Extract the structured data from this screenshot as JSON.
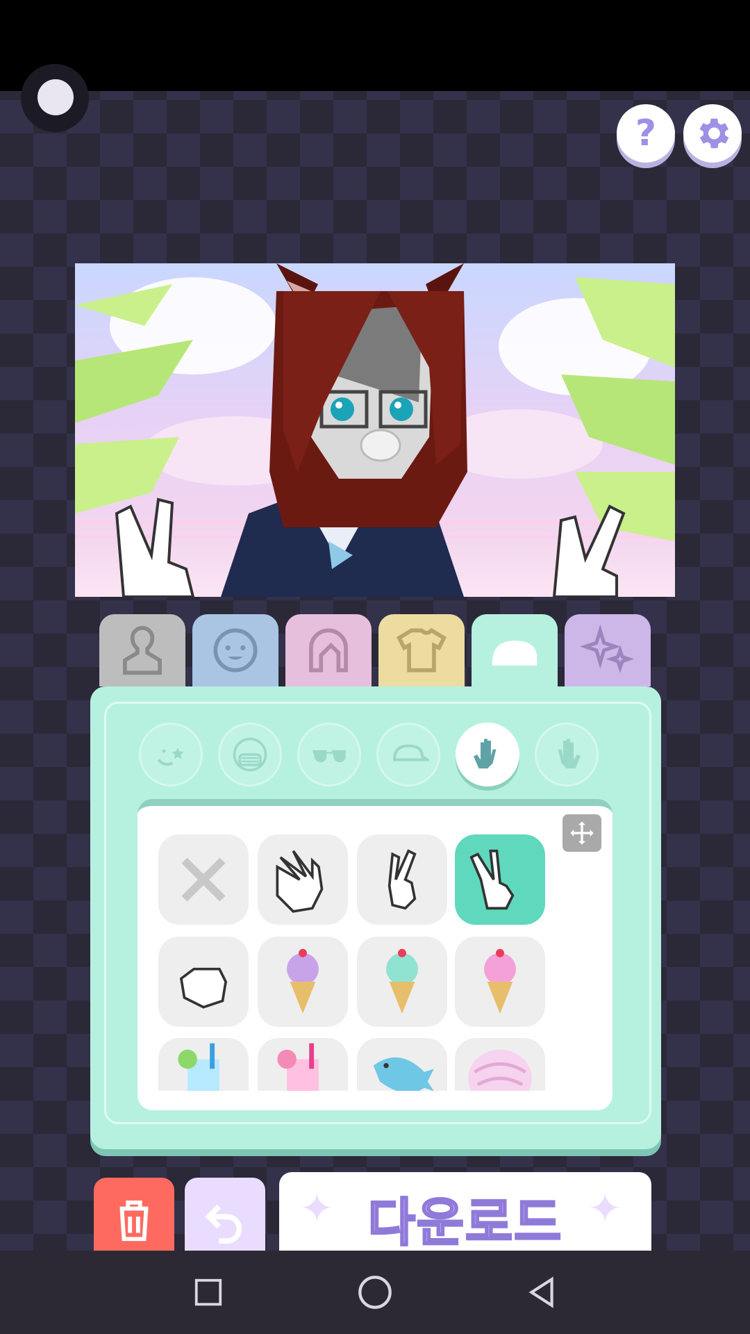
{
  "top_buttons": {
    "help_label": "?"
  },
  "tabs": [
    {
      "name": "silhouette",
      "color": "#bdbdbd",
      "icon": "silhouette-icon"
    },
    {
      "name": "face",
      "color": "#a9c5e3",
      "icon": "baby-face-icon"
    },
    {
      "name": "hair",
      "color": "#e6bfdc",
      "icon": "hair-icon"
    },
    {
      "name": "clothes",
      "color": "#ecdca0",
      "icon": "tshirt-icon"
    },
    {
      "name": "accessories",
      "color": "#b6f1e0",
      "icon": "cap-icon",
      "active": true
    },
    {
      "name": "effects",
      "color": "#cdb7e8",
      "icon": "sparkle-icon"
    }
  ],
  "sub_categories": [
    "face-sticker-icon",
    "mask-icon",
    "sunglasses-icon",
    "cap-icon",
    "left-hand-icon",
    "right-hand-icon"
  ],
  "active_sub_category": 4,
  "items": [
    {
      "name": "none-item",
      "icon": "close-icon",
      "selected": false
    },
    {
      "name": "open-hand-item",
      "icon": "open-hand-icon",
      "selected": false
    },
    {
      "name": "peace-sign-item",
      "icon": "peace-sign-icon",
      "selected": false
    },
    {
      "name": "peace-sign-alt-item",
      "icon": "peace-sign-icon",
      "selected": true
    },
    {
      "name": "fist-item",
      "icon": "fist-icon",
      "selected": false
    },
    {
      "name": "purple-ice-cream-item",
      "icon": "ice-cream-icon",
      "selected": false
    },
    {
      "name": "mint-ice-cream-item",
      "icon": "ice-cream-icon",
      "selected": false
    },
    {
      "name": "pink-ice-cream-item",
      "icon": "ice-cream-icon",
      "selected": false
    },
    {
      "name": "lime-drink-item",
      "icon": "drink-icon",
      "selected": false
    },
    {
      "name": "pink-drink-item",
      "icon": "drink-icon",
      "selected": false
    },
    {
      "name": "dolphin-item",
      "icon": "dolphin-icon",
      "selected": false
    },
    {
      "name": "shell-item",
      "icon": "shell-icon",
      "selected": false
    }
  ],
  "actions": {
    "download_label": "다운로드"
  },
  "colors": {
    "accent": "#5fd8bd",
    "panel": "#b6f1e0",
    "trash": "#ff6a60",
    "undo": "#eadcff",
    "download_text": "#c9a9f5"
  }
}
